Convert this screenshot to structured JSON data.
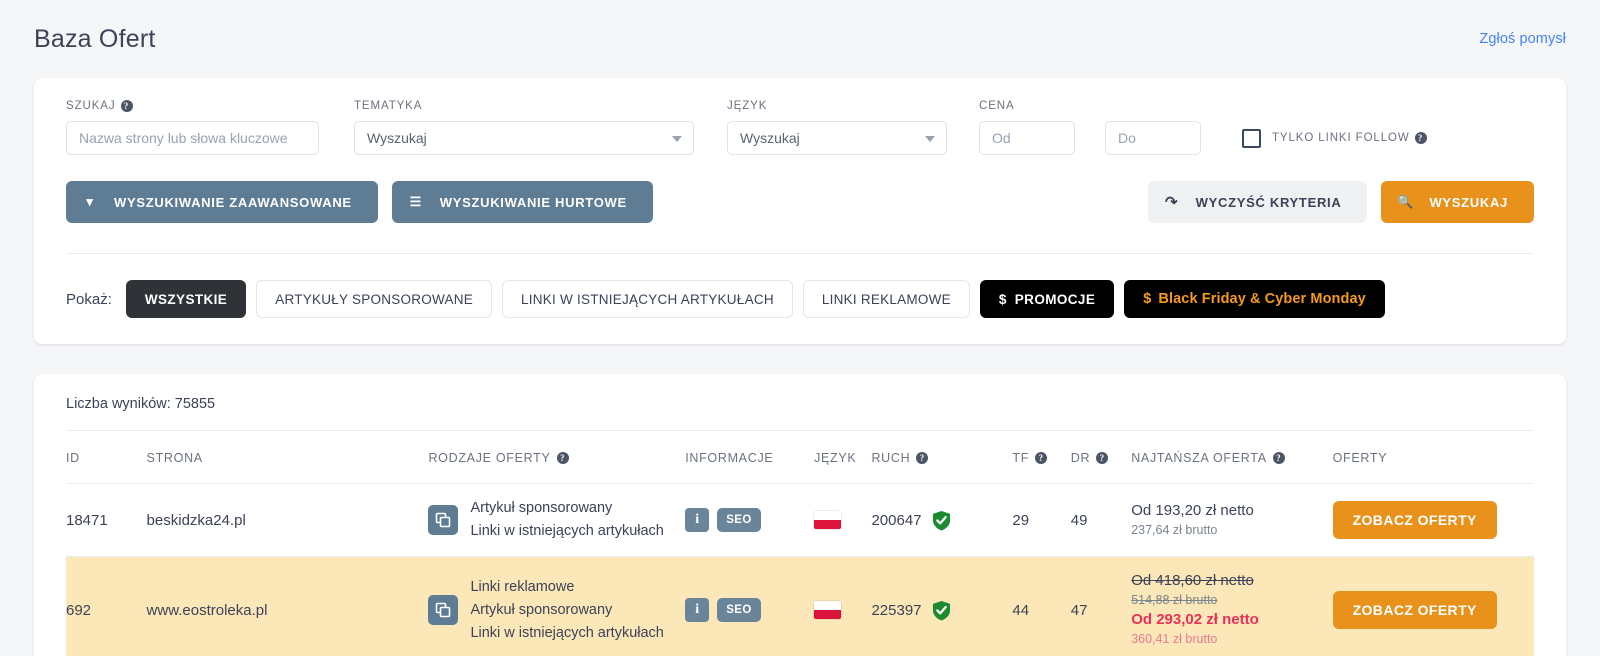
{
  "header": {
    "title": "Baza Ofert",
    "report_link": "Zgłoś pomysł"
  },
  "filters": {
    "search": {
      "label": "SZUKAJ",
      "placeholder": "Nazwa strony lub słowa kluczowe",
      "value": ""
    },
    "topic": {
      "label": "TEMATYKA",
      "value": "Wyszukaj"
    },
    "language": {
      "label": "JĘZYK",
      "value": "Wyszukaj"
    },
    "price": {
      "label": "CENA",
      "from_placeholder": "Od",
      "to_placeholder": "Do",
      "from_value": "",
      "to_value": ""
    },
    "follow_only": {
      "label": "TYLKO LINKI FOLLOW",
      "checked": false
    }
  },
  "actions": {
    "advanced_search": "WYSZUKIWANIE ZAAWANSOWANE",
    "bulk_search": "WYSZUKIWANIE HURTOWE",
    "clear_criteria": "WYCZYŚĆ KRYTERIA",
    "search": "WYSZUKAJ"
  },
  "show": {
    "label": "Pokaż:",
    "tabs": [
      {
        "label": "WSZYSTKIE",
        "state": "active"
      },
      {
        "label": "ARTYKUŁY SPONSOROWANE",
        "state": "default"
      },
      {
        "label": "LINKI W ISTNIEJĄCYCH ARTYKUŁACH",
        "state": "default"
      },
      {
        "label": "LINKI REKLAMOWE",
        "state": "default"
      },
      {
        "label": "PROMOCJE",
        "state": "black",
        "icon": "dollar"
      },
      {
        "label": "Black Friday & Cyber Monday",
        "state": "black-friday",
        "icon": "dollar"
      }
    ]
  },
  "results": {
    "count_text": "Liczba wyników: 75855",
    "columns": [
      "ID",
      "STRONA",
      "RODZAJE OFERTY",
      "INFORMACJE",
      "JĘZYK",
      "RUCH",
      "TF",
      "DR",
      "NAJTAŃSZA OFERTA",
      "OFERTY"
    ],
    "rows": [
      {
        "id": "18471",
        "site": "beskidzka24.pl",
        "types": [
          "Artykuł sponsorowany",
          "Linki w istniejących artykułach"
        ],
        "info_badges": [
          "i",
          "SEO"
        ],
        "language": "pl",
        "traffic": "200647",
        "traffic_verified": true,
        "tf": "29",
        "dr": "49",
        "price_net": "Od 193,20 zł netto",
        "price_gross": "237,64 zł brutto",
        "promo": false,
        "offers_button": "ZOBACZ OFERTY",
        "highlighted": false
      },
      {
        "id": "692",
        "site": "www.eostroleka.pl",
        "types": [
          "Linki reklamowe",
          "Artykuł sponsorowany",
          "Linki w istniejących artykułach"
        ],
        "info_badges": [
          "i",
          "SEO"
        ],
        "language": "pl",
        "traffic": "225397",
        "traffic_verified": true,
        "tf": "44",
        "dr": "47",
        "price_net": "Od 418,60 zł netto",
        "price_gross": "514,88 zł brutto",
        "promo": true,
        "promo_net": "Od 293,02 zł netto",
        "promo_gross": "360,41 zł brutto",
        "offers_button": "ZOBACZ OFERTY",
        "highlighted": true
      }
    ]
  },
  "colors": {
    "accent_orange": "#e8921c",
    "slate_button": "#5e7d94",
    "black": "#000000",
    "bf_orange": "#f59a1b",
    "promo_red": "#e6315b",
    "highlight_row": "#fce7b8",
    "link_blue": "#4285f4"
  }
}
